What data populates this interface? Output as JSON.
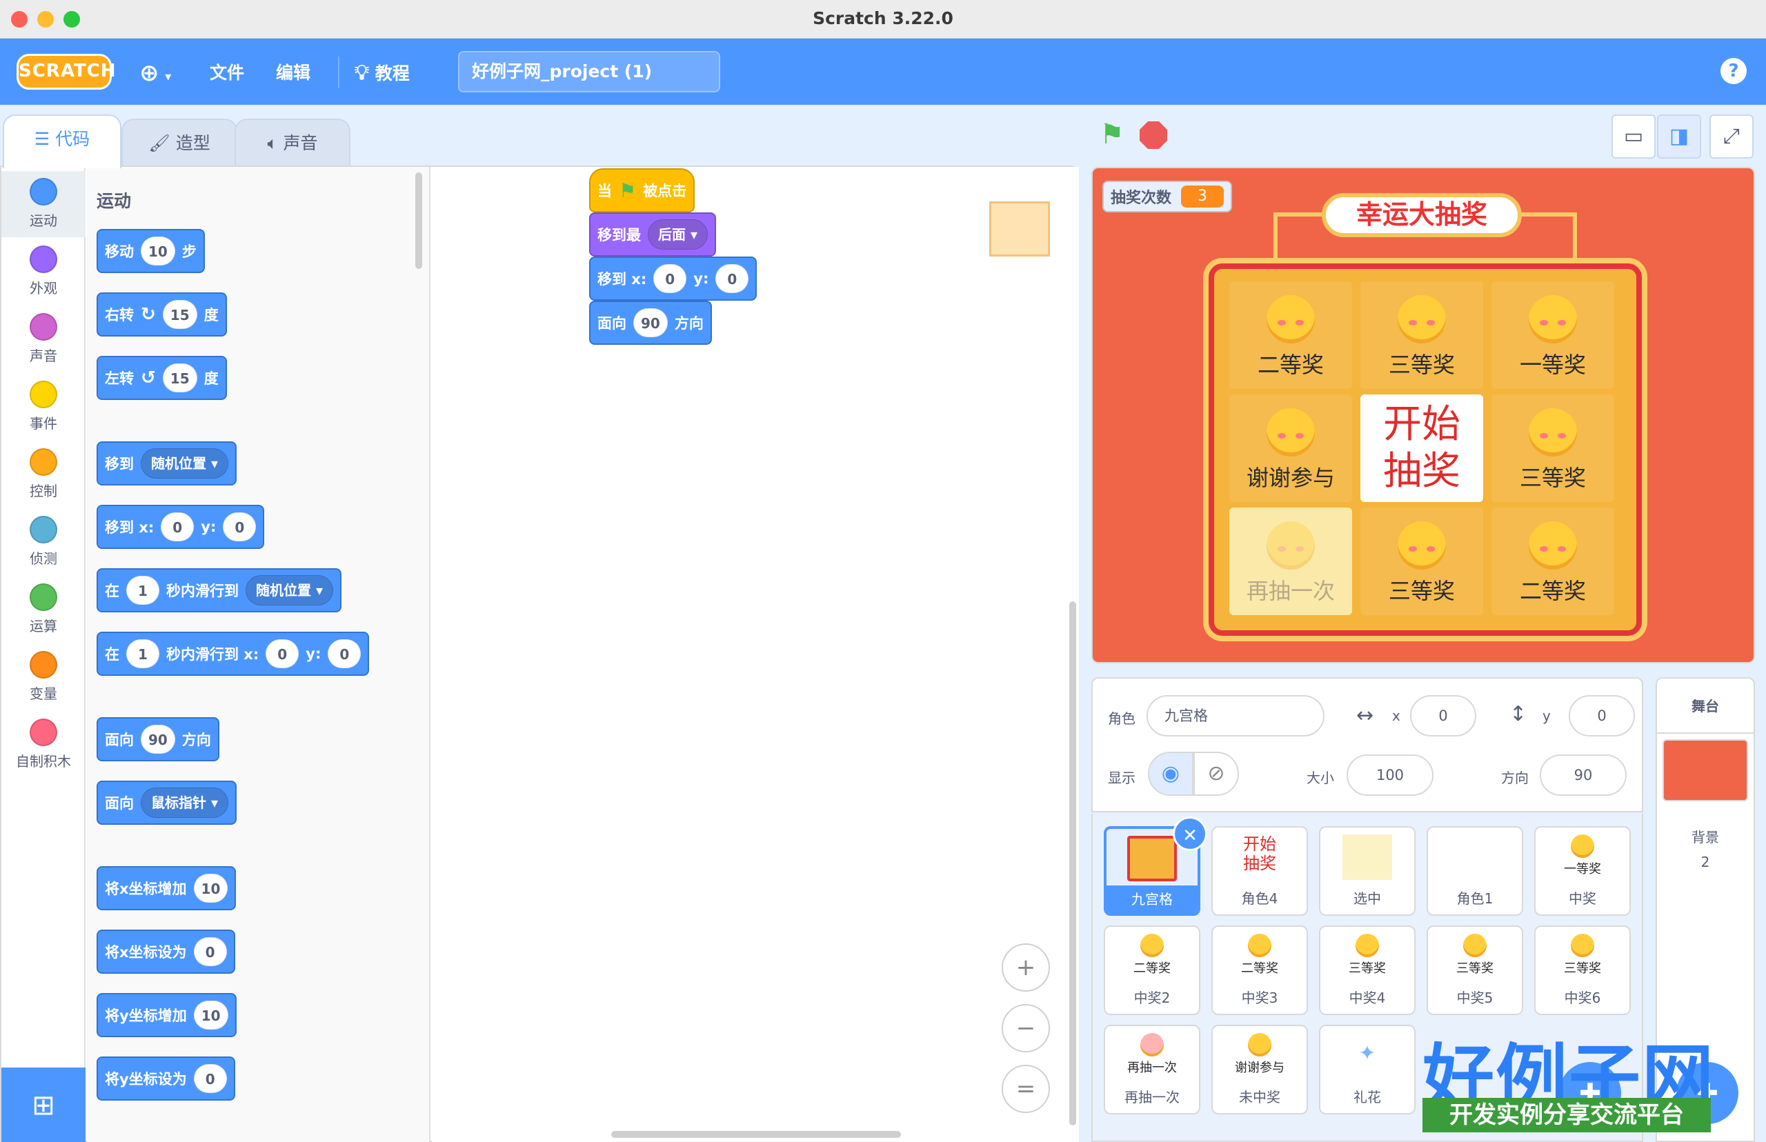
{
  "window": {
    "title": "Scratch 3.22.0"
  },
  "menu": {
    "logo": "SCRATCH",
    "globe_icon": "globe-icon",
    "file": "文件",
    "edit": "编辑",
    "tutorials": "教程",
    "project_title": "好例子网_project (1)",
    "help": "?"
  },
  "tabs": [
    {
      "label": "代码",
      "icon": "code-icon",
      "active": true
    },
    {
      "label": "造型",
      "icon": "brush-icon",
      "active": false
    },
    {
      "label": "声音",
      "icon": "speaker-icon",
      "active": false
    }
  ],
  "categories": [
    {
      "label": "运动",
      "color": "#4c97ff"
    },
    {
      "label": "外观",
      "color": "#9966ff"
    },
    {
      "label": "声音",
      "color": "#cf63cf"
    },
    {
      "label": "事件",
      "color": "#ffd500"
    },
    {
      "label": "控制",
      "color": "#ffab19"
    },
    {
      "label": "侦测",
      "color": "#5cb1d6"
    },
    {
      "label": "运算",
      "color": "#59c059"
    },
    {
      "label": "变量",
      "color": "#ff8c1a"
    },
    {
      "label": "自制积木",
      "color": "#ff6680"
    }
  ],
  "palette": {
    "heading": "运动",
    "move": {
      "a": "移动",
      "v": "10",
      "b": "步"
    },
    "turn_right": {
      "a": "右转",
      "v": "15",
      "b": "度"
    },
    "turn_left": {
      "a": "左转",
      "v": "15",
      "b": "度"
    },
    "goto": {
      "a": "移到",
      "dd": "随机位置"
    },
    "goto_xy": {
      "a": "移到 x:",
      "x": "0",
      "b": "y:",
      "y": "0"
    },
    "glide": {
      "a": "在",
      "v": "1",
      "b": "秒内滑行到",
      "dd": "随机位置"
    },
    "glide_xy": {
      "a": "在",
      "v": "1",
      "b": "秒内滑行到 x:",
      "x": "0",
      "c": "y:",
      "y": "0"
    },
    "point_dir": {
      "a": "面向",
      "v": "90",
      "b": "方向"
    },
    "point_towards": {
      "a": "面向",
      "dd": "鼠标指针"
    },
    "change_x": {
      "a": "将x坐标增加",
      "v": "10"
    },
    "set_x": {
      "a": "将x坐标设为",
      "v": "0"
    },
    "change_y": {
      "a": "将y坐标增加",
      "v": "10"
    },
    "set_y": {
      "a": "将y坐标设为",
      "v": "0"
    }
  },
  "script": {
    "hat": {
      "a": "当",
      "b": "被点击"
    },
    "layer": {
      "a": "移到最",
      "dd": "后面"
    },
    "goto_xy": {
      "a": "移到 x:",
      "x": "0",
      "b": "y:",
      "y": "0"
    },
    "point_dir": {
      "a": "面向",
      "v": "90",
      "b": "方向"
    }
  },
  "zoom": {
    "in": "+",
    "out": "−",
    "reset": "="
  },
  "stage": {
    "counter_label": "抽奖次数",
    "counter_value": "3",
    "board_title": "幸运大抽奖",
    "cells": [
      "二等奖",
      "三等奖",
      "一等奖",
      "谢谢参与",
      "开始 抽奖",
      "三等奖",
      "再抽一次",
      "三等奖",
      "二等奖"
    ],
    "start_line1": "开始",
    "start_line2": "抽奖"
  },
  "sprite_info": {
    "sprite_label": "角色",
    "sprite_name": "九宫格",
    "x_label": "x",
    "x_value": "0",
    "y_label": "y",
    "y_value": "0",
    "show_label": "显示",
    "size_label": "大小",
    "size_value": "100",
    "direction_label": "方向",
    "direction_value": "90"
  },
  "sprites": [
    {
      "name": "九宫格",
      "thumb": ""
    },
    {
      "name": "角色4",
      "thumb": "开始 抽奖"
    },
    {
      "name": "选中",
      "thumb": ""
    },
    {
      "name": "角色1",
      "thumb": ""
    },
    {
      "name": "中奖",
      "thumb": "一等奖"
    },
    {
      "name": "中奖2",
      "thumb": "二等奖"
    },
    {
      "name": "中奖3",
      "thumb": "二等奖"
    },
    {
      "name": "中奖4",
      "thumb": "三等奖"
    },
    {
      "name": "中奖5",
      "thumb": "三等奖"
    },
    {
      "name": "中奖6",
      "thumb": "三等奖"
    },
    {
      "name": "再抽一次",
      "thumb": "再抽一次"
    },
    {
      "name": "未中奖",
      "thumb": "谢谢参与"
    },
    {
      "name": "礼花",
      "thumb": ""
    }
  ],
  "stage_panel": {
    "heading": "舞台",
    "backdrops_label": "背景",
    "backdrops_count": "2"
  },
  "watermark": {
    "logo": "好例子网",
    "tagline": "开发实例分享交流平台"
  }
}
